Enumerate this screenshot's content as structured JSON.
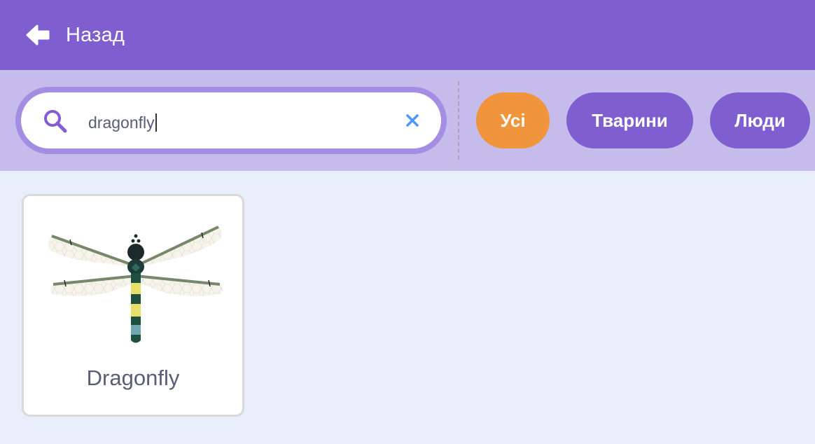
{
  "header": {
    "back_label": "Назад",
    "back_icon": "arrow-left-icon",
    "color": "#7f5fd0"
  },
  "search": {
    "value": "dragonfly",
    "search_icon": "search-icon",
    "clear_icon": "close-icon"
  },
  "tags": [
    {
      "label": "Усі",
      "selected": true,
      "color": "#f0953c"
    },
    {
      "label": "Тварини",
      "selected": false,
      "color": "#7f5fd0"
    },
    {
      "label": "Люди",
      "selected": false,
      "color": "#7f5fd0"
    }
  ],
  "results": [
    {
      "name": "Dragonfly",
      "image": "dragonfly-sprite"
    }
  ]
}
